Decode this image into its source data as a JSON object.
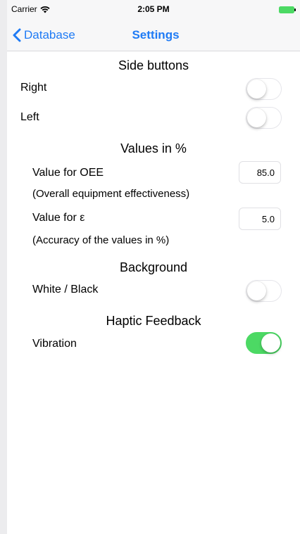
{
  "status_bar": {
    "carrier": "Carrier",
    "time": "2:05 PM",
    "wifi_icon": "wifi-icon",
    "battery_icon": "battery-icon"
  },
  "nav": {
    "back_label": "Database",
    "back_icon": "chevron-left-icon",
    "title": "Settings"
  },
  "sections": {
    "side_buttons": {
      "header": "Side buttons",
      "right_label": "Right",
      "right_on": false,
      "left_label": "Left",
      "left_on": false
    },
    "values": {
      "header": "Values in %",
      "oee_label": "Value for OEE",
      "oee_sublabel": "(Overall equipment effectiveness)",
      "oee_value": "85.0",
      "eps_label": "Value for ε",
      "eps_sublabel": "(Accuracy of the values in %)",
      "eps_value": "5.0"
    },
    "background": {
      "header": "Background",
      "label": "White / Black",
      "on": false
    },
    "haptic": {
      "header": "Haptic Feedback",
      "label": "Vibration",
      "on": true
    }
  },
  "colors": {
    "accent": "#1f7bf5",
    "toggle_on": "#4cd964",
    "toggle_off_border": "#e5e5ea"
  }
}
